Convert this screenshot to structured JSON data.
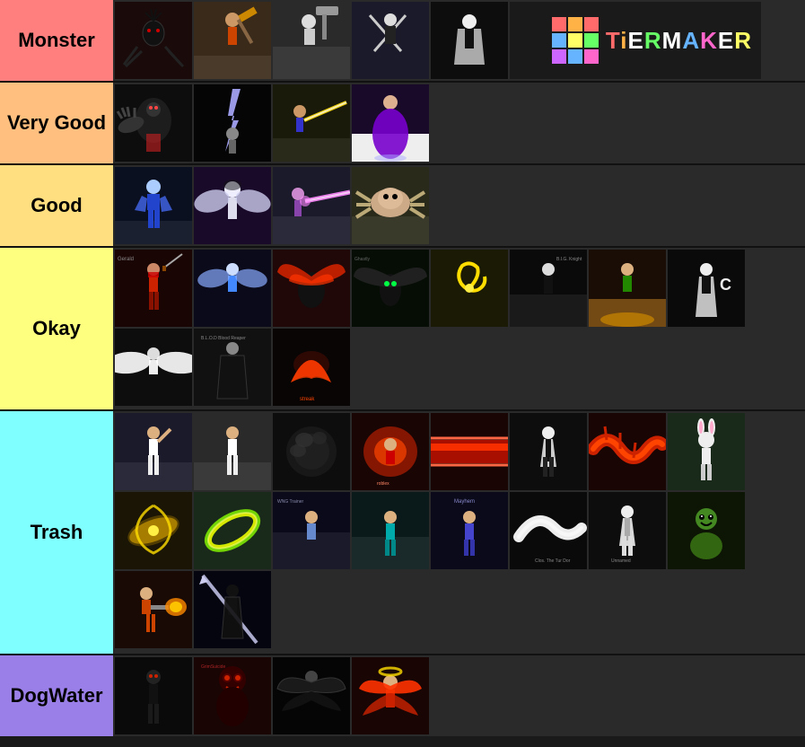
{
  "tiers": [
    {
      "id": "monster",
      "label": "Monster",
      "color": "#ff7f7f",
      "items": [
        {
          "id": "m1",
          "bg": "#1a0a0a",
          "desc": "dark spider creature"
        },
        {
          "id": "m2",
          "bg": "#2a1a0a",
          "desc": "character with weapon outdoors"
        },
        {
          "id": "m3",
          "bg": "#0a1a0a",
          "desc": "white character with hammer"
        },
        {
          "id": "m4",
          "bg": "#1a1a2a",
          "desc": "dark figure swords"
        },
        {
          "id": "m5",
          "bg": "#0a0a1a",
          "desc": "black white character"
        },
        {
          "id": "m6",
          "bg": "#1a1a1a",
          "desc": "colorful blocks logo area"
        }
      ],
      "isHeader": true
    },
    {
      "id": "very-good",
      "label": "Very Good",
      "color": "#ffbf7f",
      "items": [
        {
          "id": "vg1",
          "bg": "#1a1a1a",
          "desc": "creature claws dark"
        },
        {
          "id": "vg2",
          "bg": "#0a0a0a",
          "desc": "dark scene lightning"
        },
        {
          "id": "vg3",
          "bg": "#1a1a0a",
          "desc": "character golden sword"
        },
        {
          "id": "vg4",
          "bg": "#1a0a2a",
          "desc": "purple dress figure"
        }
      ]
    },
    {
      "id": "good",
      "label": "Good",
      "color": "#ffdf7f",
      "items": [
        {
          "id": "g1",
          "bg": "#0a1a2a",
          "desc": "blue armored character"
        },
        {
          "id": "g2",
          "bg": "#1a0a2a",
          "desc": "white winged figure"
        },
        {
          "id": "g3",
          "bg": "#1a1a2a",
          "desc": "character laser beam"
        },
        {
          "id": "g4",
          "bg": "#2a2a1a",
          "desc": "spider creature tan"
        }
      ]
    },
    {
      "id": "okay",
      "label": "Okay",
      "color": "#ffff7f",
      "items": [
        {
          "id": "o1",
          "bg": "#2a0a0a",
          "desc": "red ninja character"
        },
        {
          "id": "o2",
          "bg": "#1a1a2a",
          "desc": "blue winged character"
        },
        {
          "id": "o3",
          "bg": "#2a0a0a",
          "desc": "red wing creature"
        },
        {
          "id": "o4",
          "bg": "#0a1a0a",
          "desc": "dark winged black creature"
        },
        {
          "id": "o5",
          "bg": "#2a2a0a",
          "desc": "yellow spiral object"
        },
        {
          "id": "o6",
          "bg": "#1a1a1a",
          "desc": "black white character city"
        },
        {
          "id": "o7",
          "bg": "#2a1a0a",
          "desc": "character orange platform"
        },
        {
          "id": "o8",
          "bg": "#1a1a1a",
          "desc": "black white figure"
        },
        {
          "id": "o9",
          "bg": "#1a1a1a",
          "desc": "white winged small character"
        },
        {
          "id": "o10",
          "bg": "#1a1a1a",
          "desc": "dark character reaper"
        },
        {
          "id": "o11",
          "bg": "#1a0a0a",
          "desc": "red scythe weapon"
        }
      ]
    },
    {
      "id": "trash",
      "label": "Trash",
      "color": "#7fffff",
      "items": [
        {
          "id": "t1",
          "bg": "#1a1a2a",
          "desc": "white outfit character raised arm"
        },
        {
          "id": "t2",
          "bg": "#2a2a2a",
          "desc": "white outfit character"
        },
        {
          "id": "t3",
          "bg": "#1a1a1a",
          "desc": "dark particle effect"
        },
        {
          "id": "t4",
          "bg": "#2a0a0a",
          "desc": "red explosion character"
        },
        {
          "id": "t5",
          "bg": "#2a0a0a",
          "desc": "red slashing effect"
        },
        {
          "id": "t6",
          "bg": "#1a1a1a",
          "desc": "black white formal character"
        },
        {
          "id": "t7",
          "bg": "#2a0a0a",
          "desc": "red tentacle creature"
        },
        {
          "id": "t8",
          "bg": "#1a2a1a",
          "desc": "bunny outfit character"
        },
        {
          "id": "t9",
          "bg": "#2a2a0a",
          "desc": "golden spiral orb"
        },
        {
          "id": "t10",
          "bg": "#1a2a1a",
          "desc": "green yellow halo"
        },
        {
          "id": "t11",
          "bg": "#1a1a2a",
          "desc": "character WNG label"
        },
        {
          "id": "t12",
          "bg": "#1a1a1a",
          "desc": "teal character city"
        },
        {
          "id": "t13",
          "bg": "#1a1a1a",
          "desc": "blue Mayhem character"
        },
        {
          "id": "t14",
          "bg": "#1a1a1a",
          "desc": "white tail creature"
        },
        {
          "id": "t15",
          "bg": "#1a1a1a",
          "desc": "white suit character"
        },
        {
          "id": "t16",
          "bg": "#1a2a1a",
          "desc": "green creature"
        },
        {
          "id": "t17",
          "bg": "#2a1a0a",
          "desc": "fire gun character"
        },
        {
          "id": "t18",
          "bg": "#1a1a2a",
          "desc": "dark character lance weapon"
        }
      ]
    },
    {
      "id": "dogwater",
      "label": "DogWater",
      "color": "#9b7fe8",
      "items": [
        {
          "id": "dw1",
          "bg": "#1a1a1a",
          "desc": "dark character"
        },
        {
          "id": "dw2",
          "bg": "#2a0a0a",
          "desc": "red dark skull character"
        },
        {
          "id": "dw3",
          "bg": "#1a1a1a",
          "desc": "dark winged figure"
        },
        {
          "id": "dw4",
          "bg": "#2a0a0a",
          "desc": "red angelic figure"
        }
      ]
    }
  ],
  "logo": {
    "text": "TiERMAKER",
    "colors": [
      "#ff6b6b",
      "#ffb347",
      "#ffff66",
      "#66ff66",
      "#66b3ff",
      "#cc66ff",
      "#ff66cc",
      "#ffffff",
      "#ffffff"
    ]
  }
}
